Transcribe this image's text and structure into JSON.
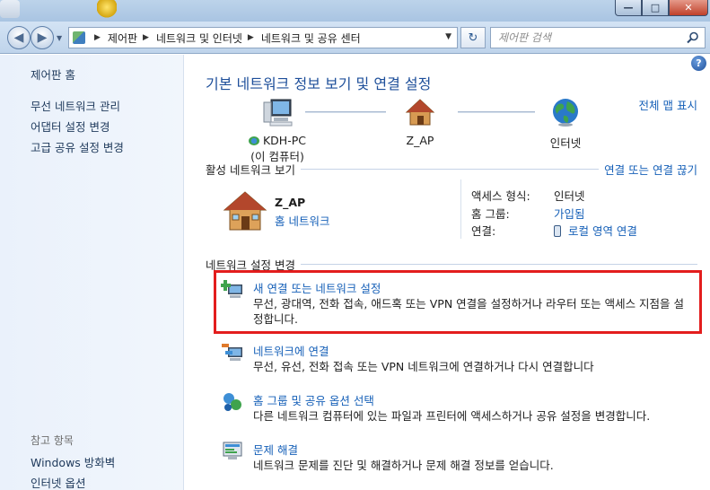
{
  "window": {
    "minimize_glyph": "—",
    "maximize_glyph": "□",
    "close_glyph": "✕"
  },
  "address": {
    "back_glyph": "◀",
    "forward_glyph": "▶",
    "breadcrumbs": [
      "제어판",
      "네트워크 및 인터넷",
      "네트워크 및 공유 센터"
    ],
    "refresh_glyph": "↻"
  },
  "search": {
    "placeholder": "제어판 검색"
  },
  "sidebar": {
    "home": "제어판 홈",
    "items": [
      {
        "label": "무선 네트워크 관리"
      },
      {
        "label": "어댑터 설정 변경"
      },
      {
        "label": "고급 공유 설정 변경"
      }
    ],
    "see_also_title": "참고 항목",
    "see_also": [
      {
        "label": "Windows 방화벽"
      },
      {
        "label": "인터넷 옵션"
      }
    ]
  },
  "main": {
    "help_glyph": "?",
    "title": "기본 네트워크 정보 보기 및 연결 설정",
    "full_map_link": "전체 맵 표시",
    "map": {
      "pc_name": "KDH-PC",
      "pc_sub": "(이 컴퓨터)",
      "ap_name": "Z_AP",
      "internet": "인터넷"
    },
    "active": {
      "section_title": "활성 네트워크 보기",
      "connect_link": "연결 또는 연결 끊기",
      "network_name": "Z_AP",
      "network_type": "홈 네트워크",
      "props": [
        {
          "key": "액세스 형식:",
          "value": "인터넷"
        },
        {
          "key": "홈 그룹:",
          "value": "가입됨"
        },
        {
          "key": "연결:",
          "value": "로컬 영역 연결"
        }
      ]
    },
    "change": {
      "section_title": "네트워크 설정 변경",
      "tasks": [
        {
          "title": "새 연결 또는 네트워크 설정",
          "desc_1": "무선, 광대역, 전화 접속, 애드혹 또는 VPN 연결을 설정하거나 라우터 또는 액세스 지점을 설",
          "desc_2": "정합니다."
        },
        {
          "title": "네트워크에 연결",
          "desc_1": "무선, 유선, 전화 접속 또는 VPN 네트워크에 연결하거나 다시 연결합니다"
        },
        {
          "title": "홈 그룹 및 공유 옵션 선택",
          "desc_1": "다른 네트워크 컴퓨터에 있는 파일과 프린터에 액세스하거나 공유 설정을 변경합니다."
        },
        {
          "title": "문제 해결",
          "desc_1": "네트워크 문제를 진단 및 해결하거나 문제 해결 정보를 얻습니다."
        }
      ]
    }
  }
}
